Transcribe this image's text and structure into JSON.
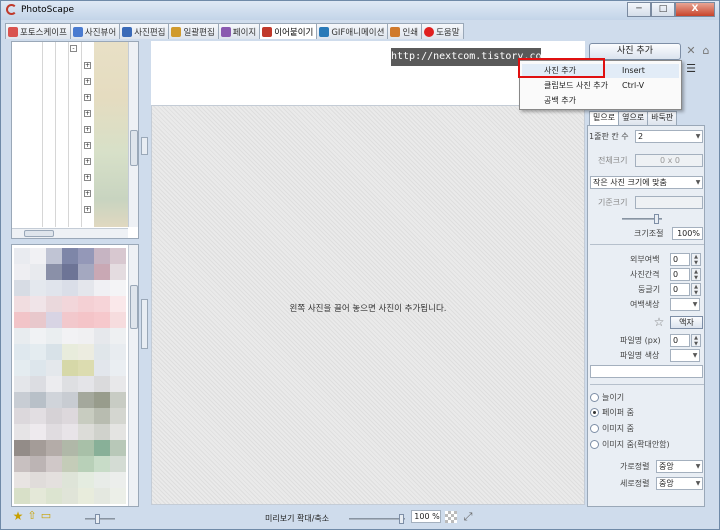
{
  "window": {
    "title": "PhotoScape",
    "buttons": [
      "─",
      "□",
      "X"
    ]
  },
  "tabs": [
    {
      "label": "포토스케이프",
      "color": "#d9534f"
    },
    {
      "label": "사진뷰어",
      "color": "#4a7bd0"
    },
    {
      "label": "사진편집",
      "color": "#3a6ab8"
    },
    {
      "label": "일괄편집",
      "color": "#d09a2c"
    },
    {
      "label": "페이지",
      "color": "#8a5ab0"
    },
    {
      "label": "이어붙이기",
      "color": "#c0392b"
    },
    {
      "label": "GIF애니메이션",
      "color": "#2a7ab8"
    },
    {
      "label": "인쇄",
      "color": "#d07a2c"
    },
    {
      "label": "도움말",
      "color": "#e02020"
    }
  ],
  "watermark": "http://nextcom.tistory.com",
  "add_photo_button": "사진 추가",
  "context_menu": [
    {
      "label": "사진 추가",
      "shortcut": "Insert",
      "highlighted": true
    },
    {
      "label": "클립보드 사진 추가",
      "shortcut": "Ctrl-V",
      "highlighted": false
    },
    {
      "label": "공백 추가",
      "shortcut": "",
      "highlighted": false
    }
  ],
  "canvas_message": "왼쪽 사진을 끌어 놓으면 사진이 추가됩니다.",
  "right_panel": {
    "tabs": [
      "밑으로",
      "옆으로",
      "바둑판"
    ],
    "grid_count_label": "1줄판 칸 수",
    "grid_count_value": "2",
    "total_size_label": "전체크기",
    "total_size_value": "0 x 0",
    "fit_option": "작은 사진 크기에 맞춤",
    "base_size_label": "기준크기",
    "scale_label": "크기조절",
    "scale_value": "100%",
    "outer_margin_label": "외부여백",
    "outer_margin_value": "0",
    "spacing_label": "사진간격",
    "spacing_value": "0",
    "rounding_label": "둥글기",
    "rounding_value": "0",
    "margin_color_label": "여백색상",
    "frame_button": "액자",
    "frame_line_label": "파일명 (px)",
    "frame_line_value": "0",
    "frame_line_color_label": "파일명 색상",
    "radio_options": [
      {
        "label": "늘이기",
        "checked": false
      },
      {
        "label": "페이퍼 줌",
        "checked": true
      },
      {
        "label": "이미지 줌",
        "checked": false
      },
      {
        "label": "이미지 줌(확대안함)",
        "checked": false
      }
    ],
    "h_align_label": "가로정렬",
    "h_align_value": "중앙",
    "v_align_label": "세로정렬",
    "v_align_value": "중앙"
  },
  "statusbar": {
    "preview_zoom_label": "미리보기 확대/축소",
    "zoom_value": "100 %"
  }
}
